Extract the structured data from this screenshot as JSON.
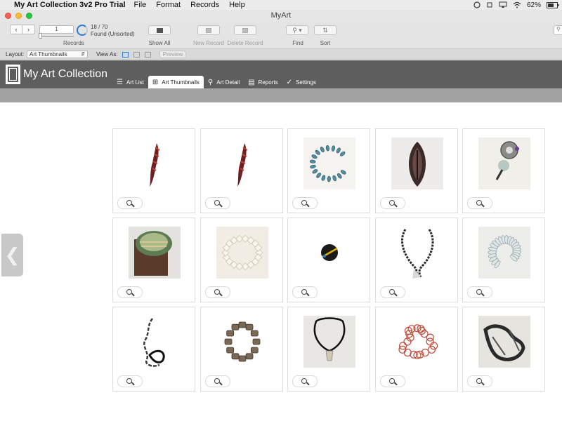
{
  "menubar": {
    "app_name": "My Art Collection 3v2 Pro Trial",
    "items": [
      "File",
      "Format",
      "Records",
      "Help"
    ],
    "battery": "62%"
  },
  "window": {
    "title": "MyArt"
  },
  "toolbar": {
    "current_record": "1",
    "records_label": "Records",
    "found_count": "18 / 70",
    "found_status": "Found (Unsorted)",
    "found_fraction": 0.257,
    "show_all_label": "Show All",
    "new_record_label": "New Record",
    "delete_record_label": "Delete Record",
    "find_label": "Find",
    "sort_label": "Sort"
  },
  "layoutbar": {
    "layout_label": "Layout:",
    "layout_value": "Art Thumbnails",
    "view_as_label": "View As:",
    "preview_label": "Preview"
  },
  "app": {
    "title": "My Art Collection",
    "tabs": [
      {
        "label": "Art List",
        "icon": "list-icon"
      },
      {
        "label": "Art Thumbnails",
        "icon": "grid-icon"
      },
      {
        "label": "Art Detail",
        "icon": "magnifier-icon"
      },
      {
        "label": "Reports",
        "icon": "report-icon"
      },
      {
        "label": "Settings",
        "icon": "checkmark-icon"
      }
    ],
    "active_tab": "Art Thumbnails"
  },
  "thumbnails": [
    {
      "kind": "feather",
      "bg": "#ffffff"
    },
    {
      "kind": "feather",
      "bg": "#ffffff"
    },
    {
      "kind": "ring-beads",
      "bg": "#f4f3ef"
    },
    {
      "kind": "pod",
      "bg": "#eeecea"
    },
    {
      "kind": "brooch",
      "bg": "#f1efea"
    },
    {
      "kind": "box",
      "bg": "#e4e2de"
    },
    {
      "kind": "pearl-bracelet",
      "bg": "#f1ede4"
    },
    {
      "kind": "disc",
      "bg": "#ffffff"
    },
    {
      "kind": "chain-necklace",
      "bg": "#ffffff"
    },
    {
      "kind": "wave",
      "bg": "#ededea"
    },
    {
      "kind": "link-chain",
      "bg": "#ffffff"
    },
    {
      "kind": "stone-bracelet",
      "bg": "#ffffff"
    },
    {
      "kind": "pendant-cord",
      "bg": "#e9e7e3"
    },
    {
      "kind": "red-rings",
      "bg": "#ffffff"
    },
    {
      "kind": "dark-sculpture",
      "bg": "#e6e4df"
    }
  ]
}
